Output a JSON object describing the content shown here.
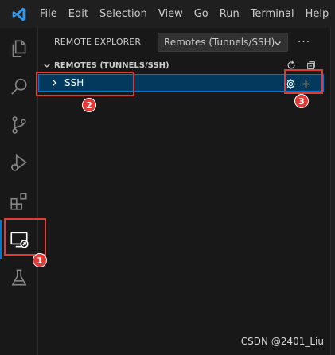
{
  "menubar": {
    "items": [
      {
        "label": "File"
      },
      {
        "label": "Edit"
      },
      {
        "label": "Selection"
      },
      {
        "label": "View"
      },
      {
        "label": "Go"
      },
      {
        "label": "Run"
      },
      {
        "label": "Terminal"
      },
      {
        "label": "Help"
      }
    ]
  },
  "activitybar": {
    "items": [
      {
        "icon": "files-icon"
      },
      {
        "icon": "search-icon"
      },
      {
        "icon": "source-control-icon"
      },
      {
        "icon": "run-debug-icon"
      },
      {
        "icon": "extensions-icon"
      },
      {
        "icon": "remote-explorer-icon",
        "active": true
      },
      {
        "icon": "testing-icon"
      }
    ]
  },
  "sidebar": {
    "title": "REMOTE EXPLORER",
    "select": {
      "value": "Remotes (Tunnels/SSH)"
    },
    "more_label": "···",
    "section": {
      "title": "REMOTES (TUNNELS/SSH)",
      "items": [
        {
          "label": "SSH"
        }
      ]
    }
  },
  "annotations": {
    "badge_1": "1",
    "badge_2": "2",
    "badge_3": "3",
    "color": "#e53935"
  },
  "watermark": "CSDN @2401_Liu",
  "colors": {
    "accent": "#0078d4",
    "selection": "#04395e",
    "background": "#181818",
    "titlebar": "#1f1f1f",
    "logo": "#2f9bf0"
  }
}
